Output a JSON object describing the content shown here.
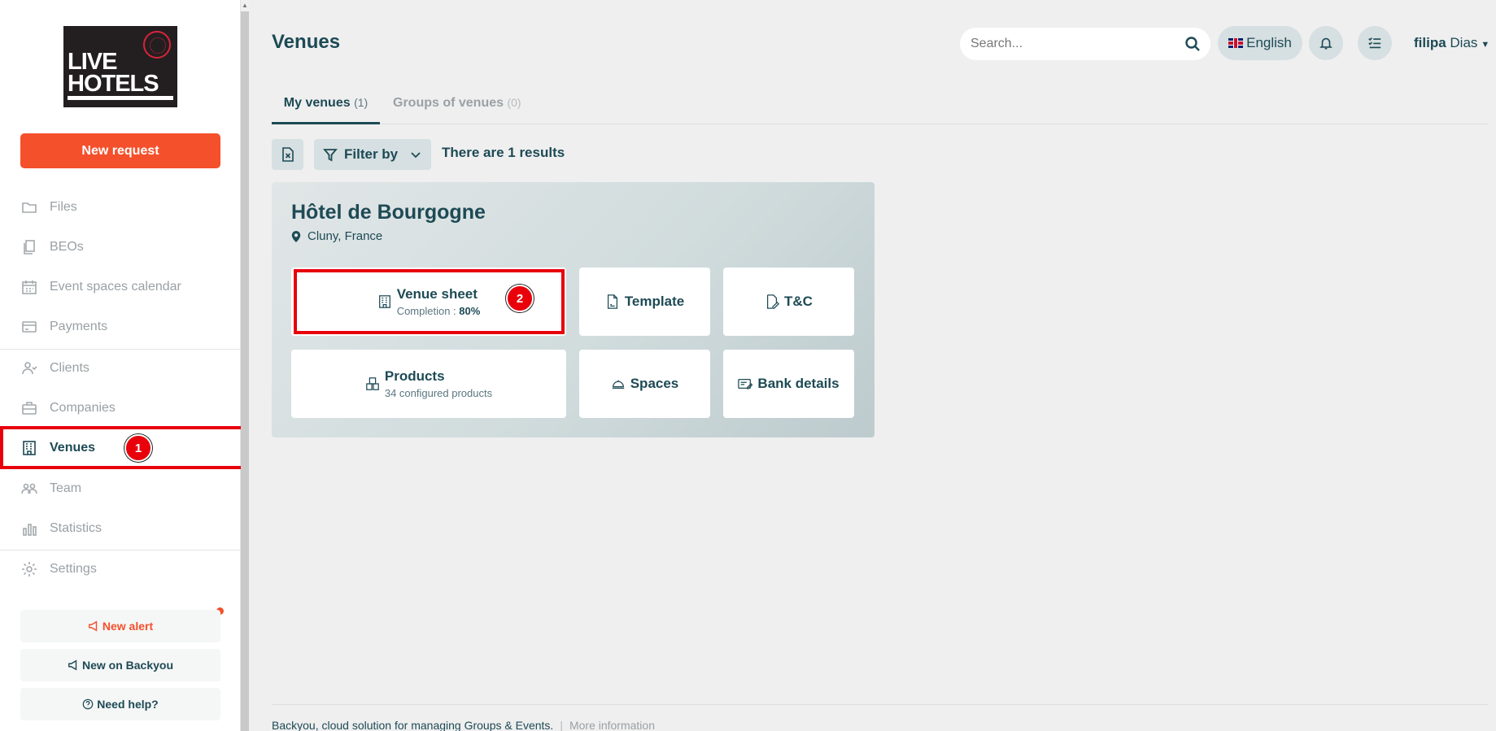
{
  "logo": {
    "line1": "LIVE",
    "line2": "HOTELS"
  },
  "sidebar": {
    "new_request": "New request",
    "items": [
      {
        "label": "Files",
        "icon": "folder-icon"
      },
      {
        "label": "BEOs",
        "icon": "documents-icon"
      },
      {
        "label": "Event spaces calendar",
        "icon": "calendar-icon"
      },
      {
        "label": "Payments",
        "icon": "credit-card-icon"
      },
      {
        "label": "Clients",
        "icon": "clients-icon"
      },
      {
        "label": "Companies",
        "icon": "briefcase-icon"
      },
      {
        "label": "Venues",
        "icon": "building-icon",
        "active": true
      },
      {
        "label": "Team",
        "icon": "team-icon"
      },
      {
        "label": "Statistics",
        "icon": "bar-chart-icon"
      },
      {
        "label": "Settings",
        "icon": "gear-icon"
      }
    ],
    "new_alert": "New alert",
    "new_on_backyou": "New on Backyou",
    "need_help": "Need help?"
  },
  "header": {
    "title": "Venues",
    "search_placeholder": "Search...",
    "language": "English",
    "user_first": "filipa",
    "user_last": "Dias"
  },
  "tabs": {
    "my_venues": "My venues",
    "my_venues_count": "(1)",
    "groups": "Groups of venues",
    "groups_count": "(0)"
  },
  "toolbar": {
    "filter_label": "Filter by",
    "results_text": "There are 1 results"
  },
  "venue": {
    "name": "Hôtel de Bourgogne",
    "location": "Cluny, France",
    "tiles": {
      "venue_sheet": "Venue sheet",
      "completion_label": "Completion : ",
      "completion_value": "80%",
      "template": "Template",
      "tc": "T&C",
      "products": "Products",
      "products_sub": "34 configured products",
      "spaces": "Spaces",
      "bank_details": "Bank details"
    }
  },
  "annotations": {
    "step1": "1",
    "step2": "2"
  },
  "footer": {
    "text": "Backyou, cloud solution for managing Groups & Events.",
    "separator": "|",
    "more": "More information"
  },
  "colors": {
    "accent": "#f4502b",
    "brand": "#1d4a55",
    "highlight": "#e8000b"
  }
}
